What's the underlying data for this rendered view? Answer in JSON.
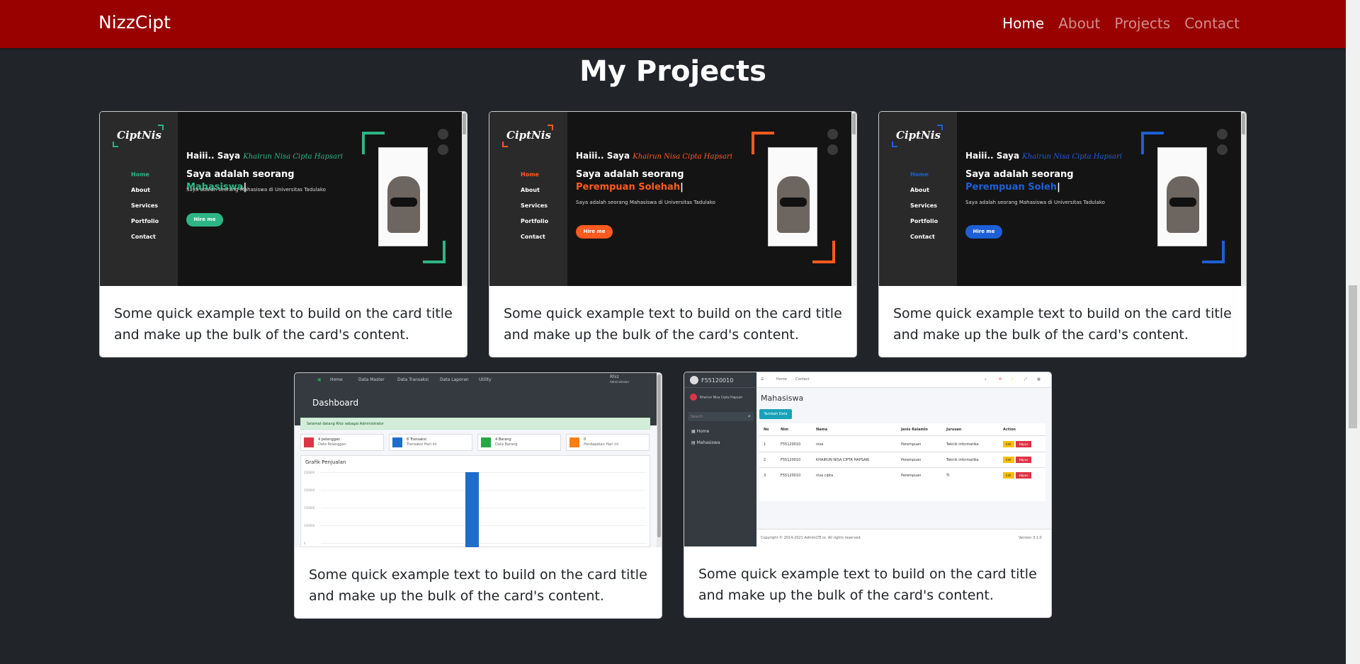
{
  "navbar": {
    "brand": "NizzCipt",
    "links": [
      "Home",
      "About",
      "Projects",
      "Contact"
    ],
    "active": "Home"
  },
  "section": {
    "title": "My Projects"
  },
  "cards": [
    {
      "text": "Some quick example text to build on the card title and make up the bulk of the card's content.",
      "preview": {
        "logo": "CiptNis",
        "menu": [
          "Home",
          "About",
          "Services",
          "Portfolio",
          "Contact"
        ],
        "greeting": "Haiii.. Saya",
        "name": "Khairun Nisa Cipta Hapsari",
        "headline": "Saya adalah seorang",
        "highlight": "Mahasiswa",
        "description": "Saya adalah seorang Mahasiswa di Universitas Tadulako",
        "button": "Hire me",
        "accent": "#2db585"
      }
    },
    {
      "text": "Some quick example text to build on the card title and make up the bulk of the card's content.",
      "preview": {
        "logo": "CiptNis",
        "menu": [
          "Home",
          "About",
          "Services",
          "Portfolio",
          "Contact"
        ],
        "greeting": "Haiii.. Saya",
        "name": "Khairun Nisa Cipta Hapsari",
        "headline": "Saya adalah seorang",
        "highlight": "Perempuan Solehah",
        "description": "Saya adalah seorang Mahasiswa di Universitas Tadulako",
        "button": "Hire me",
        "accent": "#ff5a1f"
      }
    },
    {
      "text": "Some quick example text to build on the card title and make up the bulk of the card's content.",
      "preview": {
        "logo": "CiptNis",
        "menu": [
          "Home",
          "About",
          "Services",
          "Portfolio",
          "Contact"
        ],
        "greeting": "Haiii.. Saya",
        "name": "Khairun Nisa Cipta Hapsari",
        "headline": "Saya adalah seorang",
        "highlight": "Perempuan Soleh",
        "description": "Saya adalah seorang Mahasiswa di Universitas Tadulako",
        "button": "Hire me",
        "accent": "#1d5fd6"
      }
    },
    {
      "text": "Some quick example text to build on the card title and make up the bulk of the card's content.",
      "preview": {
        "topnav": [
          "Home",
          "Data Master",
          "Data Transaksi",
          "Data Laporan",
          "Utility"
        ],
        "user": "Rhiz",
        "user_role": "Administrator",
        "title": "Dashboard",
        "alert": "Selamat datang Rhiz sebagai Administrator",
        "boxes": [
          {
            "value": "4 pelanggan",
            "label": "Data Pelanggan",
            "color": "#dc3545",
            "icon": "user-icon"
          },
          {
            "value": "8 Transaksi",
            "label": "Transaksi Hari ini",
            "color": "#1f6ccb",
            "icon": "cart-icon"
          },
          {
            "value": "4 Barang",
            "label": "Data Barang",
            "color": "#28a745",
            "icon": "list-icon"
          },
          {
            "value": "0",
            "label": "Pendapatan Hari ini",
            "color": "#fd7e14",
            "icon": "money-icon"
          }
        ],
        "chart_title": "Grafik Penjualan",
        "chart_ticks": [
          "250000",
          "200000",
          "150000",
          "100000",
          "50000",
          "0"
        ]
      }
    },
    {
      "text": "Some quick example text to build on the card title and make up the bulk of the card's content.",
      "preview": {
        "brand": "F55120010",
        "user": "Khairun Nisa Cipta Hapsari",
        "search": "Search",
        "nav": [
          "Home",
          "Mahasiswa"
        ],
        "topbar": [
          "Home",
          "Contact"
        ],
        "title": "Mahasiswa",
        "add_button": "Tambah Data",
        "columns": [
          "No",
          "Nim",
          "Nama",
          "Jenis Kelamin",
          "Jurusan",
          "Action"
        ],
        "rows": [
          [
            "1",
            "F55120010",
            "nisa",
            "Perempuan",
            "Teknik informatika"
          ],
          [
            "2",
            "F55120010",
            "KHAIRUN NISA CIPTA HAPSARI",
            "Perempuan",
            "Teknik informatika"
          ],
          [
            "3",
            "F55120010",
            "nisa cipta",
            "Perempuan",
            "TI"
          ]
        ],
        "edit_label": "Edit",
        "delete_label": "Hapus",
        "footer_left": "Copyright © 2014-2021 AdminLTE.io. All rights reserved.",
        "footer_right": "Version 3.1.0"
      }
    }
  ]
}
